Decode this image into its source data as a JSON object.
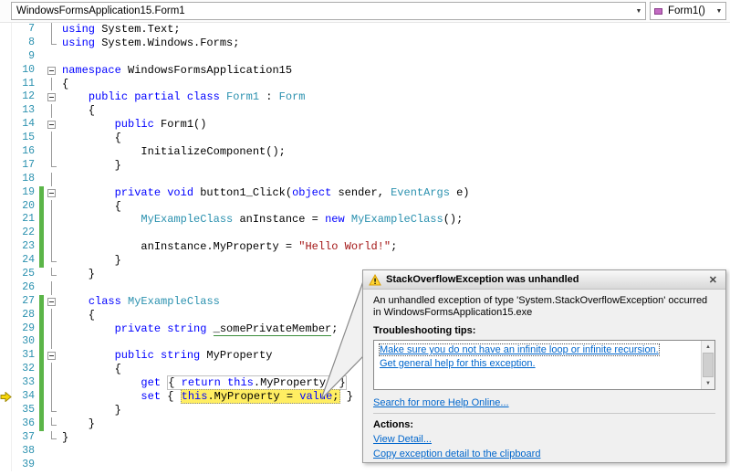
{
  "navbar": {
    "left_combo": "WindowsFormsApplication15.Form1",
    "right_combo": "Form1()"
  },
  "colors": {
    "keyword": "#0000FF",
    "user_type": "#2B91AF",
    "string_literal": "#A31515",
    "line_number": "#2B91AF",
    "execution_highlight": "#FFEE62",
    "change_bar": "#5BB548",
    "link": "#0066CC"
  },
  "editor": {
    "lines": [
      {
        "n": 7,
        "fold": "line",
        "chg": false,
        "exec": false,
        "tokens": [
          {
            "t": "using",
            "c": "kw"
          },
          {
            "t": " System.Text;",
            "c": "pl"
          }
        ]
      },
      {
        "n": 8,
        "fold": "end",
        "chg": false,
        "exec": false,
        "tokens": [
          {
            "t": "using",
            "c": "kw"
          },
          {
            "t": " System.Windows.Forms;",
            "c": "pl"
          }
        ]
      },
      {
        "n": 9,
        "fold": "none",
        "chg": false,
        "exec": false,
        "tokens": []
      },
      {
        "n": 10,
        "fold": "box",
        "chg": false,
        "exec": false,
        "tokens": [
          {
            "t": "namespace",
            "c": "kw"
          },
          {
            "t": " WindowsFormsApplication15",
            "c": "pl"
          }
        ]
      },
      {
        "n": 11,
        "fold": "line",
        "chg": false,
        "exec": false,
        "tokens": [
          {
            "t": "{",
            "c": "pl"
          }
        ]
      },
      {
        "n": 12,
        "fold": "box",
        "chg": false,
        "exec": false,
        "tokens": [
          {
            "t": "    ",
            "c": "pl"
          },
          {
            "t": "public partial class",
            "c": "kw"
          },
          {
            "t": " ",
            "c": "pl"
          },
          {
            "t": "Form1",
            "c": "ty"
          },
          {
            "t": " : ",
            "c": "pl"
          },
          {
            "t": "Form",
            "c": "ty"
          }
        ]
      },
      {
        "n": 13,
        "fold": "line",
        "chg": false,
        "exec": false,
        "tokens": [
          {
            "t": "    {",
            "c": "pl"
          }
        ]
      },
      {
        "n": 14,
        "fold": "box",
        "chg": false,
        "exec": false,
        "tokens": [
          {
            "t": "        ",
            "c": "pl"
          },
          {
            "t": "public",
            "c": "kw"
          },
          {
            "t": " Form1()",
            "c": "pl"
          }
        ]
      },
      {
        "n": 15,
        "fold": "line",
        "chg": false,
        "exec": false,
        "tokens": [
          {
            "t": "        {",
            "c": "pl"
          }
        ]
      },
      {
        "n": 16,
        "fold": "line",
        "chg": false,
        "exec": false,
        "tokens": [
          {
            "t": "            InitializeComponent();",
            "c": "pl"
          }
        ]
      },
      {
        "n": 17,
        "fold": "end",
        "chg": false,
        "exec": false,
        "tokens": [
          {
            "t": "        }",
            "c": "pl"
          }
        ]
      },
      {
        "n": 18,
        "fold": "line",
        "chg": false,
        "exec": false,
        "tokens": []
      },
      {
        "n": 19,
        "fold": "box",
        "chg": true,
        "exec": false,
        "tokens": [
          {
            "t": "        ",
            "c": "pl"
          },
          {
            "t": "private void",
            "c": "kw"
          },
          {
            "t": " button1_Click(",
            "c": "pl"
          },
          {
            "t": "object",
            "c": "kw"
          },
          {
            "t": " sender, ",
            "c": "pl"
          },
          {
            "t": "EventArgs",
            "c": "ty"
          },
          {
            "t": " e)",
            "c": "pl"
          }
        ]
      },
      {
        "n": 20,
        "fold": "line",
        "chg": true,
        "exec": false,
        "tokens": [
          {
            "t": "        {",
            "c": "pl"
          }
        ]
      },
      {
        "n": 21,
        "fold": "line",
        "chg": true,
        "exec": false,
        "tokens": [
          {
            "t": "            ",
            "c": "pl"
          },
          {
            "t": "MyExampleClass",
            "c": "ty"
          },
          {
            "t": " anInstance = ",
            "c": "pl"
          },
          {
            "t": "new",
            "c": "kw"
          },
          {
            "t": " ",
            "c": "pl"
          },
          {
            "t": "MyExampleClass",
            "c": "ty"
          },
          {
            "t": "();",
            "c": "pl"
          }
        ]
      },
      {
        "n": 22,
        "fold": "line",
        "chg": true,
        "exec": false,
        "tokens": []
      },
      {
        "n": 23,
        "fold": "line",
        "chg": true,
        "exec": false,
        "tokens": [
          {
            "t": "            anInstance.MyProperty = ",
            "c": "pl"
          },
          {
            "t": "\"Hello World!\"",
            "c": "str"
          },
          {
            "t": ";",
            "c": "pl"
          }
        ]
      },
      {
        "n": 24,
        "fold": "end",
        "chg": true,
        "exec": false,
        "tokens": [
          {
            "t": "        }",
            "c": "pl"
          }
        ]
      },
      {
        "n": 25,
        "fold": "end",
        "chg": false,
        "exec": false,
        "tokens": [
          {
            "t": "    }",
            "c": "pl"
          }
        ]
      },
      {
        "n": 26,
        "fold": "line",
        "chg": false,
        "exec": false,
        "tokens": []
      },
      {
        "n": 27,
        "fold": "box",
        "chg": true,
        "exec": false,
        "tokens": [
          {
            "t": "    ",
            "c": "pl"
          },
          {
            "t": "class",
            "c": "kw"
          },
          {
            "t": " ",
            "c": "pl"
          },
          {
            "t": "MyExampleClass",
            "c": "ty"
          }
        ]
      },
      {
        "n": 28,
        "fold": "line",
        "chg": true,
        "exec": false,
        "tokens": [
          {
            "t": "    {",
            "c": "pl"
          }
        ]
      },
      {
        "n": 29,
        "fold": "line",
        "chg": true,
        "exec": false,
        "tokens": [
          {
            "t": "        ",
            "c": "pl"
          },
          {
            "t": "private string",
            "c": "kw"
          },
          {
            "t": " ",
            "c": "pl"
          },
          {
            "t": "_somePrivateMember",
            "c": "pl uw"
          },
          {
            "t": ";",
            "c": "pl"
          }
        ]
      },
      {
        "n": 30,
        "fold": "line",
        "chg": true,
        "exec": false,
        "tokens": []
      },
      {
        "n": 31,
        "fold": "box",
        "chg": true,
        "exec": false,
        "tokens": [
          {
            "t": "        ",
            "c": "pl"
          },
          {
            "t": "public string",
            "c": "kw"
          },
          {
            "t": " MyProperty",
            "c": "pl"
          }
        ]
      },
      {
        "n": 32,
        "fold": "line",
        "chg": true,
        "exec": false,
        "tokens": [
          {
            "t": "        {",
            "c": "pl"
          }
        ]
      },
      {
        "n": 33,
        "fold": "line",
        "chg": true,
        "exec": false,
        "tokens": [
          {
            "t": "            ",
            "c": "pl"
          },
          {
            "t": "get",
            "c": "kw"
          },
          {
            "t": " ",
            "c": "pl"
          },
          {
            "t": "{ ",
            "c": "pl",
            "g": "gray"
          },
          {
            "t": "return",
            "c": "kw",
            "g": "gray"
          },
          {
            "t": " ",
            "c": "pl",
            "g": "gray"
          },
          {
            "t": "this",
            "c": "kw",
            "g": "gray"
          },
          {
            "t": ".MyProperty; }",
            "c": "pl",
            "g": "gray"
          }
        ]
      },
      {
        "n": 34,
        "fold": "line",
        "chg": true,
        "exec": true,
        "tokens": [
          {
            "t": "            ",
            "c": "pl"
          },
          {
            "t": "set",
            "c": "kw"
          },
          {
            "t": " { ",
            "c": "pl"
          },
          {
            "t": "this",
            "c": "kw",
            "g": "exec"
          },
          {
            "t": ".MyProperty = ",
            "c": "pl",
            "g": "exec"
          },
          {
            "t": "value",
            "c": "kw",
            "g": "exec"
          },
          {
            "t": ";",
            "c": "pl",
            "g": "exec"
          },
          {
            "t": " }",
            "c": "pl"
          }
        ]
      },
      {
        "n": 35,
        "fold": "end",
        "chg": true,
        "exec": false,
        "tokens": [
          {
            "t": "        }",
            "c": "pl"
          }
        ]
      },
      {
        "n": 36,
        "fold": "end",
        "chg": true,
        "exec": false,
        "tokens": [
          {
            "t": "    }",
            "c": "pl"
          }
        ]
      },
      {
        "n": 37,
        "fold": "end",
        "chg": false,
        "exec": false,
        "tokens": [
          {
            "t": "}",
            "c": "pl"
          }
        ]
      },
      {
        "n": 38,
        "fold": "none",
        "chg": false,
        "exec": false,
        "tokens": []
      },
      {
        "n": 39,
        "fold": "none",
        "chg": false,
        "exec": false,
        "tokens": []
      }
    ]
  },
  "dialog": {
    "title": "StackOverflowException was unhandled",
    "close_glyph": "✕",
    "message": "An unhandled exception of type 'System.StackOverflowException' occurred in WindowsFormsApplication15.exe",
    "troubleshooting_label": "Troubleshooting tips:",
    "tips": [
      "Make sure you do not have an infinite loop or infinite recursion.",
      "Get general help for this exception."
    ],
    "search_link": "Search for more Help Online...",
    "actions_label": "Actions:",
    "actions": [
      "View Detail...",
      "Copy exception detail to the clipboard"
    ]
  }
}
